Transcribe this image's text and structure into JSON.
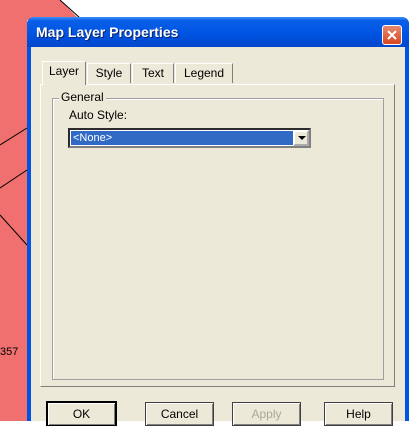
{
  "background": {
    "map_fill": "#f07070",
    "partial_label": "357"
  },
  "dialog": {
    "title": "Map Layer Properties",
    "close_icon": "close-icon",
    "tabs": [
      {
        "label": "Layer",
        "active": true
      },
      {
        "label": "Style",
        "active": false
      },
      {
        "label": "Text",
        "active": false
      },
      {
        "label": "Legend",
        "active": false
      }
    ],
    "general_group": {
      "title": "General",
      "auto_style_label": "Auto Style:",
      "auto_style_value": "<None>"
    },
    "buttons": {
      "ok": "OK",
      "cancel": "Cancel",
      "apply": "Apply",
      "help": "Help"
    }
  },
  "colors": {
    "titlebar": "#0054e3",
    "face": "#ece9d8",
    "selection": "#316ac5",
    "close": "#d6461f"
  }
}
